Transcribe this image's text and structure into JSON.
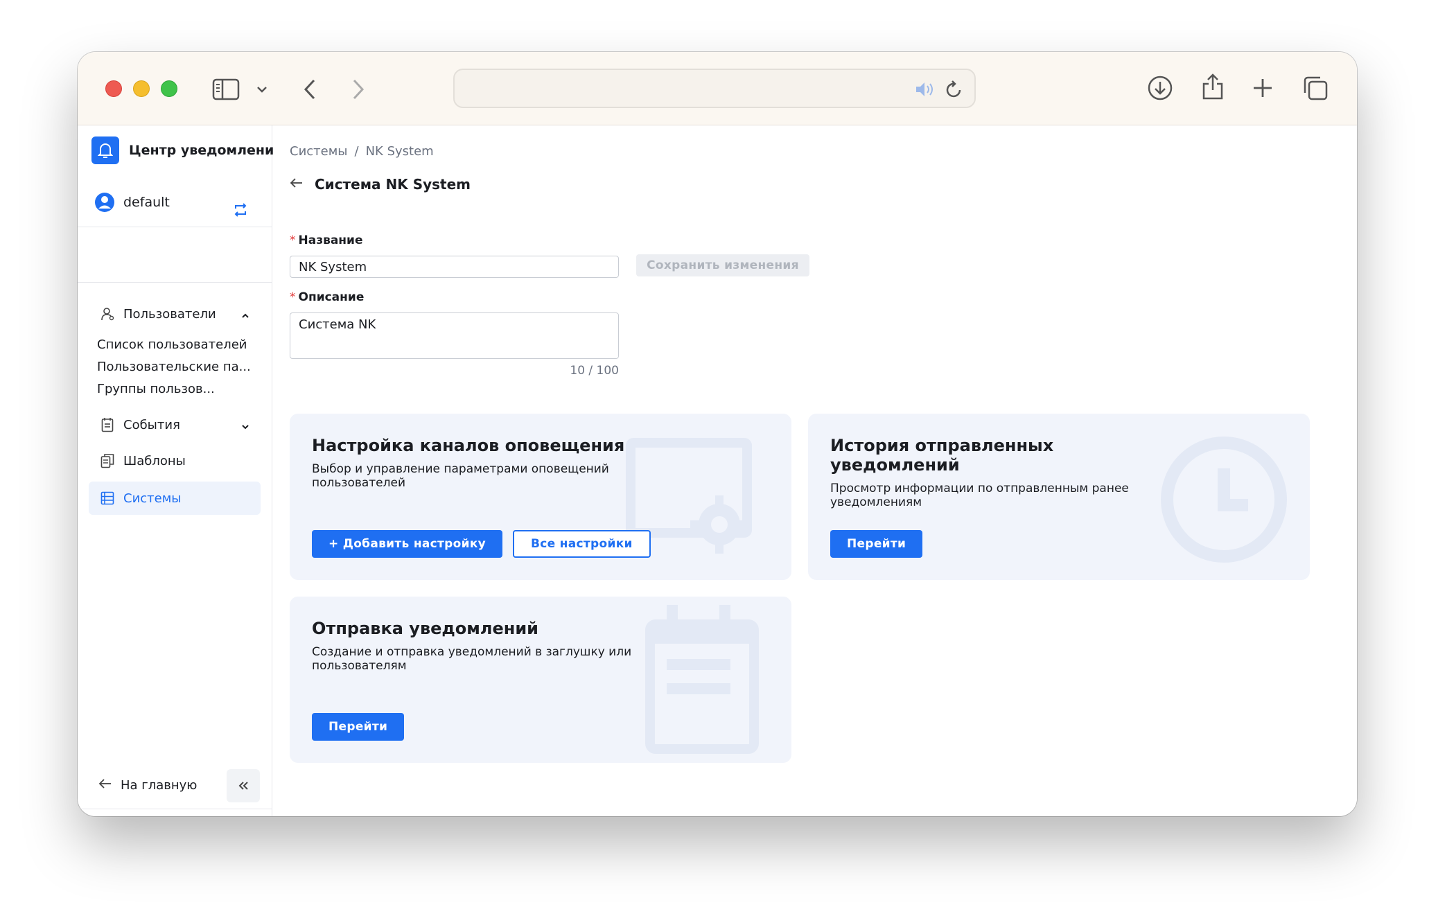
{
  "colors": {
    "accent": "#1f6ff2",
    "card_bg": "#f1f4fb",
    "required": "#e23b3b"
  },
  "browser": {
    "icons": [
      "sidebar-toggle-icon",
      "chevron-down-icon",
      "back-icon",
      "forward-icon",
      "speaker-icon",
      "reload-icon",
      "download-icon",
      "share-icon",
      "new-tab-icon",
      "tabs-overview-icon"
    ],
    "address": ""
  },
  "sidebar": {
    "brand": "Центр уведомлений",
    "user": "default",
    "nav": {
      "users": "Пользователи",
      "users_sub": [
        "Список пользователей",
        "Пользовательские па...",
        "Группы пользов..."
      ],
      "events": "События",
      "templates": "Шаблоны",
      "systems": "Системы"
    },
    "home": "На главную"
  },
  "breadcrumb": {
    "first": "Системы",
    "sep": "/",
    "current": "NK System"
  },
  "page": {
    "title": "Система NK System"
  },
  "form": {
    "name_label": "Название",
    "name_value": "NK System",
    "save_label": "Сохранить изменения",
    "desc_label": "Описание",
    "desc_value": "Система NK",
    "counter": "10 / 100",
    "required_mark": "*"
  },
  "cards": {
    "channels": {
      "title": "Настройка каналов оповещения",
      "desc": "Выбор и управление параметрами оповещений пользователей",
      "btn_add": "+ Добавить настройку",
      "btn_all": "Все настройки"
    },
    "history": {
      "title": "История отправленных уведомлений",
      "desc": "Просмотр информации по отправленным ранее уведомлениям",
      "btn": "Перейти"
    },
    "send": {
      "title": "Отправка уведомлений",
      "desc": "Создание и отправка уведомлений в заглушку или пользователям",
      "btn": "Перейти"
    }
  }
}
